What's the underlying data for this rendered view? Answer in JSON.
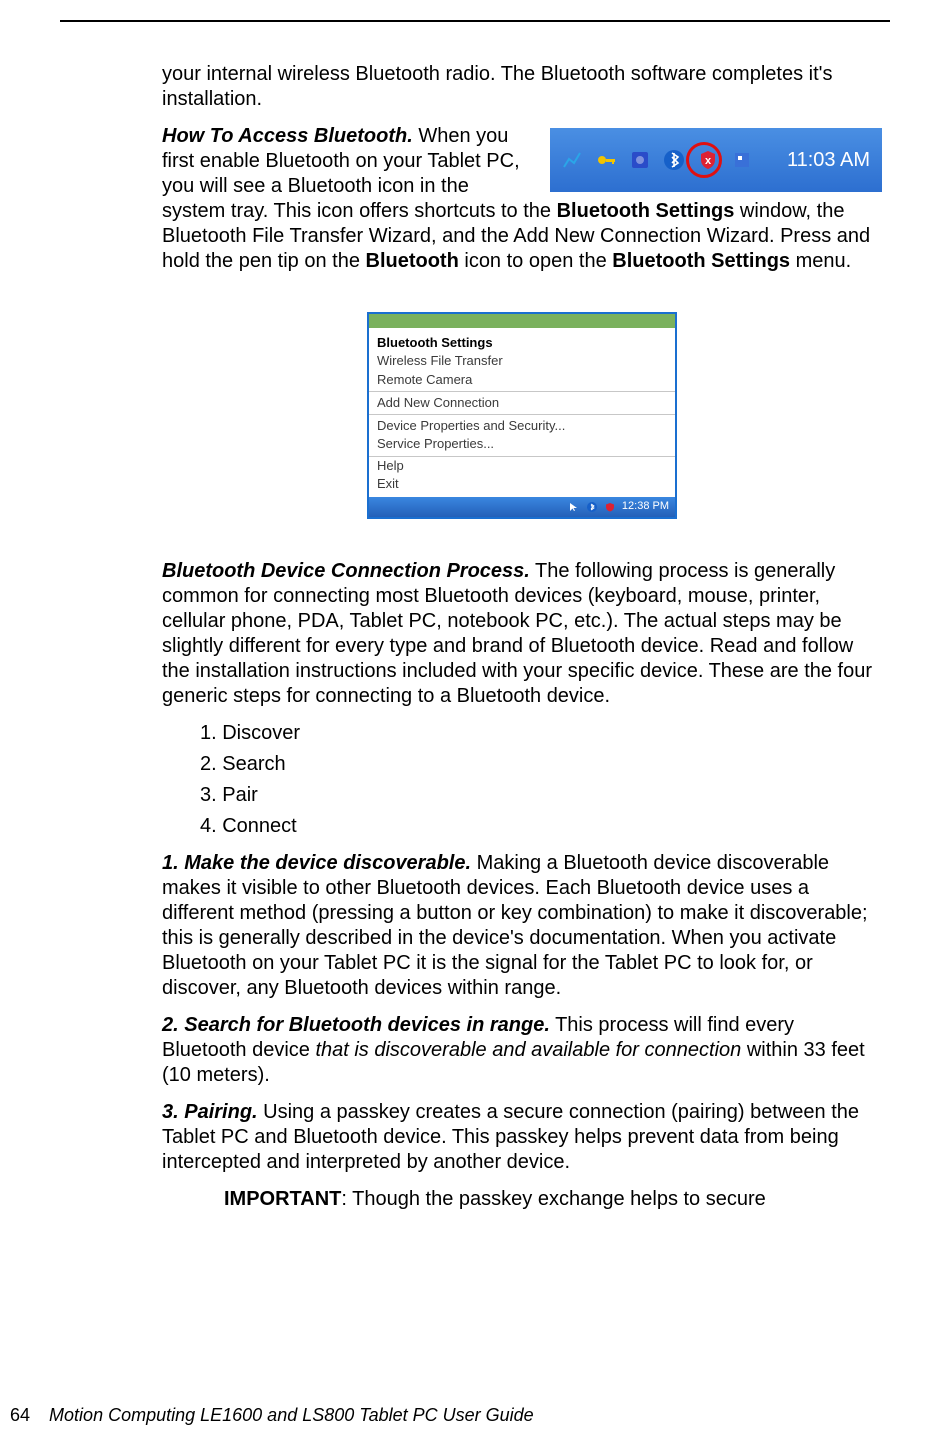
{
  "intro_continuation": "your internal wireless Bluetooth radio. The Bluetooth software completes it's installation.",
  "howto": {
    "heading": "How To Access Bluetooth.",
    "text1": " When you first enable Bluetooth on your Tablet PC, you will see a Bluetooth icon in the system tray. This icon offers shortcuts to the ",
    "bold1": "Bluetooth Settings",
    "text2": " window, the Bluetooth File Transfer Wizard, and the Add New Connection Wizard. Press and hold the pen tip on the ",
    "bold2": "Bluetooth",
    "text3": " icon to open the ",
    "bold3": "Bluetooth Settings",
    "text4": " menu."
  },
  "systray": {
    "time": "11:03 AM",
    "icons": {
      "net": "net-icon",
      "key": "key-icon",
      "blue": "square-icon",
      "bt": "bluetooth-icon",
      "shield": "shield-icon",
      "fw": "fw-icon"
    }
  },
  "menu": {
    "title": "Bluetooth Settings",
    "items_top": [
      "Wireless File Transfer",
      "Remote Camera"
    ],
    "item_add": "Add New Connection",
    "items_props": [
      "Device Properties and Security...",
      "Service Properties..."
    ],
    "items_bottom": [
      "Help",
      "Exit"
    ],
    "time": "12:38 PM"
  },
  "process": {
    "heading": "Bluetooth Device Connection Process.",
    "text": " The following process is generally common for connecting most Bluetooth devices (keyboard, mouse, printer, cellular phone, PDA, Tablet PC, notebook PC, etc.). The actual steps may be slightly different for every type and brand of Bluetooth device. Read and follow the installation instructions included with your specific device. These are the four generic steps for connecting to a Bluetooth device."
  },
  "steps": [
    "1. Discover",
    "2. Search",
    "3. Pair",
    "4. Connect"
  ],
  "step1": {
    "heading": "1. Make the device discoverable.",
    "text": " Making a Bluetooth device discoverable makes it visible to other Bluetooth devices. Each Bluetooth device uses a different method (pressing a button or key combination) to make it discoverable; this is generally described in the device's documentation. When you activate Bluetooth on your Tablet PC it is the signal for the Tablet PC to look for, or discover, any Bluetooth devices within range."
  },
  "step2": {
    "heading": "2. Search for Bluetooth devices in range.",
    "text_a": " This process will find every Bluetooth device ",
    "italic": "that is discoverable and available for connection",
    "text_b": " within 33 feet (10 meters)."
  },
  "step3": {
    "heading": "3. Pairing.",
    "text": " Using a passkey creates a secure connection (pairing) between the Tablet PC and Bluetooth device. This passkey helps prevent data from being intercepted and interpreted by another device."
  },
  "important": {
    "label": "IMPORTANT",
    "text": ": Though the passkey exchange helps to secure"
  },
  "footer": {
    "page": "64",
    "title": "Motion Computing LE1600 and LS800 Tablet PC User Guide"
  }
}
